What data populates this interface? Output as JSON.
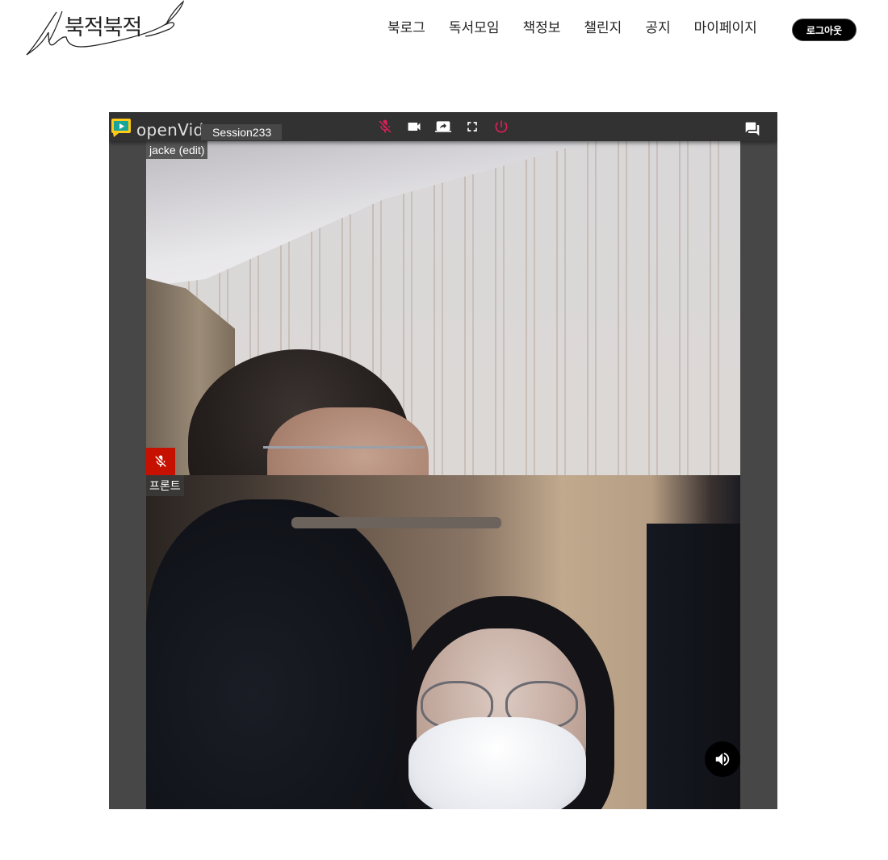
{
  "header": {
    "logo_text": "북적북적",
    "nav": [
      "북로그",
      "독서모임",
      "책정보",
      "챌린지",
      "공지",
      "마이페이지"
    ],
    "logout_label": "로그아웃"
  },
  "video": {
    "brand": "openVidu",
    "session_name": "Session233",
    "toolbar_icons": [
      "mic-off-icon",
      "camera-icon",
      "screen-share-icon",
      "fullscreen-icon",
      "power-icon",
      "chat-icon"
    ],
    "streams": [
      {
        "nickname": "jacke (edit)",
        "muted": true
      },
      {
        "nickname": "프론트",
        "volume_icon": "volume-icon"
      }
    ],
    "colors": {
      "toolbar": "#323232",
      "background": "#474747",
      "accent_red": "#e01e5a",
      "mute_badge": "#c71100"
    }
  }
}
